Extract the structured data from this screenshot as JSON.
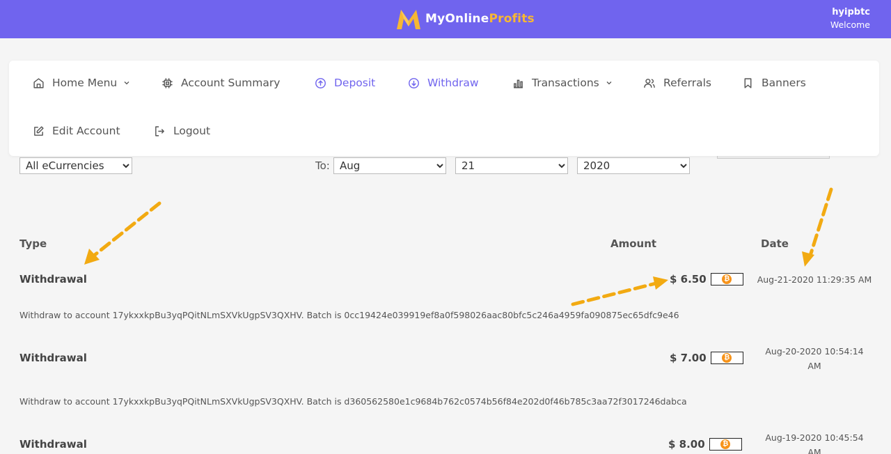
{
  "header": {
    "logo_text_primary": "MyOnline",
    "logo_text_accent": "Profits",
    "username": "hyipbtc",
    "welcome": "Welcome",
    "colors": {
      "bar": "#7064ee",
      "accent": "#f7b733"
    }
  },
  "menu": {
    "items": [
      {
        "label": "Home Menu",
        "icon": "home-icon",
        "dropdown": true
      },
      {
        "label": "Account Summary",
        "icon": "chip-icon"
      },
      {
        "label": "Deposit",
        "icon": "arrow-up-circle-icon",
        "active": true
      },
      {
        "label": "Withdraw",
        "icon": "arrow-down-circle-icon",
        "active": true
      },
      {
        "label": "Transactions",
        "icon": "bar-chart-icon",
        "dropdown": true
      },
      {
        "label": "Referrals",
        "icon": "users-icon"
      },
      {
        "label": "Banners",
        "icon": "bookmark-icon"
      },
      {
        "label": "Edit Account",
        "icon": "edit-icon"
      },
      {
        "label": "Logout",
        "icon": "logout-icon"
      }
    ]
  },
  "filters": {
    "ecurrency": "All eCurrencies",
    "to_label": "To:",
    "to_month": "Aug",
    "to_day": "21",
    "to_year": "2020"
  },
  "table": {
    "headers": {
      "type": "Type",
      "amount": "Amount",
      "date": "Date"
    },
    "rows": [
      {
        "type": "Withdrawal",
        "amount": "$ 6.50",
        "date": "Aug-21-2020 11:29:35 AM",
        "description": "Withdraw to account 17ykxxkpBu3yqPQitNLmSXVkUgpSV3QXHV. Batch is 0cc19424e039919ef8a0f598026aac80bfc5c246a4959fa090875ec65dfc9e46"
      },
      {
        "type": "Withdrawal",
        "amount": "$ 7.00",
        "date_line1": "Aug-20-2020 10:54:14",
        "date_line2": "AM",
        "description": "Withdraw to account 17ykxxkpBu3yqPQitNLmSXVkUgpSV3QXHV. Batch is d360562580e1c9684b762c0574b56f84e202d0f46b785c3aa72f3017246dabca"
      },
      {
        "type": "Withdrawal",
        "amount": "$ 8.00",
        "date_line1": "Aug-19-2020 10:45:54",
        "date_line2": "AM"
      }
    ],
    "currency_icon": "bitcoin-icon",
    "currency_color": "#f7931a"
  },
  "annotations": {
    "arrow_color": "#f2aa12"
  }
}
